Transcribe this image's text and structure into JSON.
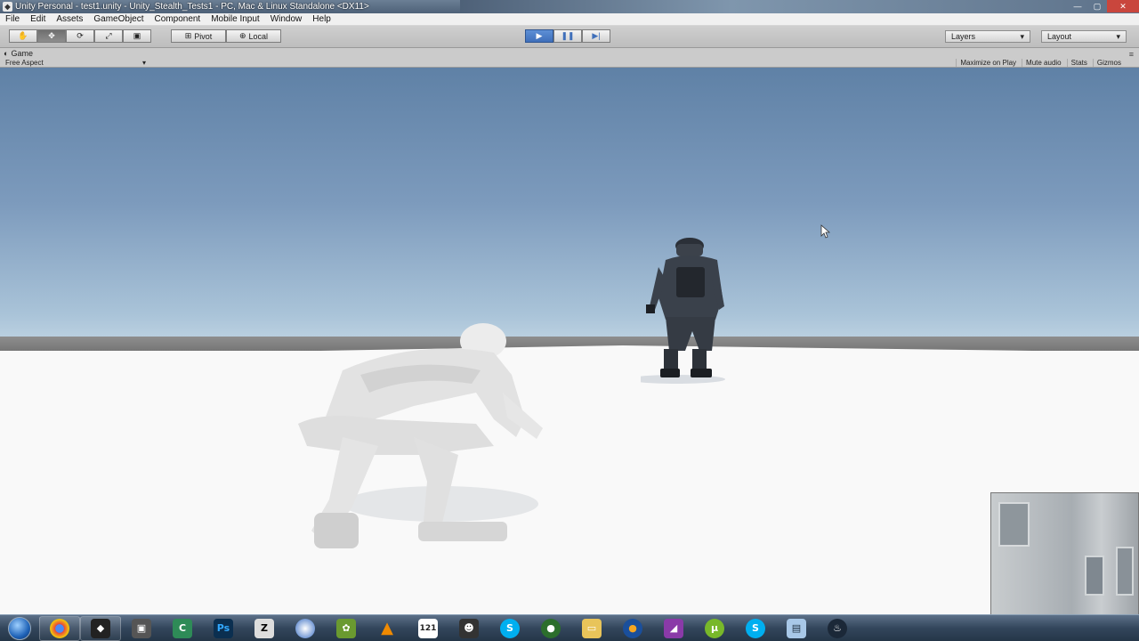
{
  "window": {
    "title": "Unity Personal - test1.unity - Unity_Stealth_Tests1 - PC, Mac & Linux Standalone <DX11>"
  },
  "menu": [
    "File",
    "Edit",
    "Assets",
    "GameObject",
    "Component",
    "Mobile Input",
    "Window",
    "Help"
  ],
  "toolbar": {
    "transform_tools": [
      "hand-icon",
      "move-icon",
      "rotate-icon",
      "scale-icon",
      "rect-icon"
    ],
    "pivot_label": "Pivot",
    "local_label": "Local",
    "play_buttons": [
      "play-icon",
      "pause-icon",
      "step-icon"
    ],
    "layers_label": "Layers",
    "layout_label": "Layout"
  },
  "game_view": {
    "tab_label": "Game",
    "aspect_label": "Free Aspect",
    "options": [
      "Maximize on Play",
      "Mute audio",
      "Stats",
      "Gizmos"
    ]
  },
  "taskbar": {
    "icons": [
      "start-orb",
      "chrome-icon",
      "unity-icon",
      "app-icon",
      "camtasia-icon",
      "photoshop-icon",
      "zbrush-icon",
      "sphere-icon",
      "photos-icon",
      "vlc-icon",
      "calendar-icon",
      "mask-icon",
      "skype-icon",
      "network-icon",
      "folder-icon",
      "ball-icon",
      "car-icon",
      "utorrent-icon",
      "skype-icon-2",
      "file-icon",
      "steam-icon"
    ]
  },
  "colors": {
    "sky_top": "#5f81a6",
    "sky_horizon": "#eef5f7",
    "floor": "#f9f9f9",
    "play_accent": "#3f6fba"
  }
}
